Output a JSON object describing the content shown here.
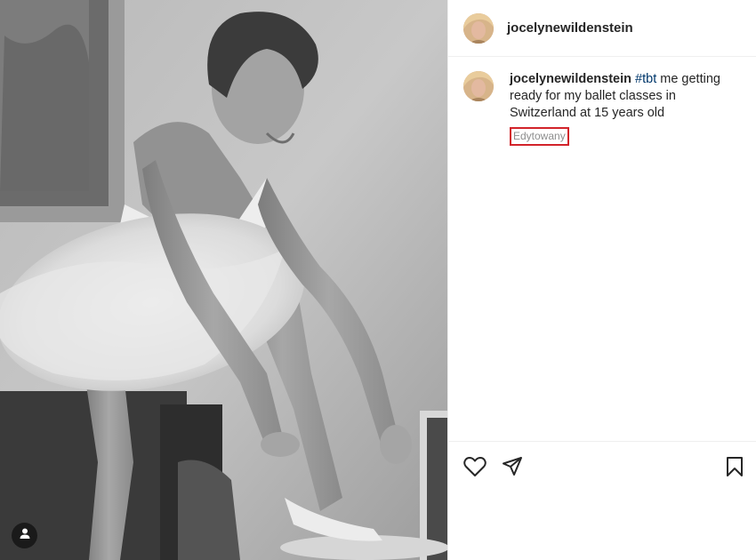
{
  "post": {
    "username": "jocelynewildenstein",
    "caption": {
      "username": "jocelynewildenstein",
      "hashtag": "#tbt",
      "text": " me getting ready for my ballet classes in Switzerland at 15 years old",
      "edited_label": "Edytowany"
    },
    "media": {
      "type": "photo",
      "style": "black-and-white",
      "user_tag_icon": "user-icon"
    },
    "actions": {
      "like_icon": "heart-icon",
      "share_icon": "paper-plane-icon",
      "save_icon": "bookmark-icon"
    },
    "colors": {
      "hashtag": "#00376b",
      "highlight_box": "#d2232a",
      "muted_text": "#8e8e8e"
    }
  }
}
